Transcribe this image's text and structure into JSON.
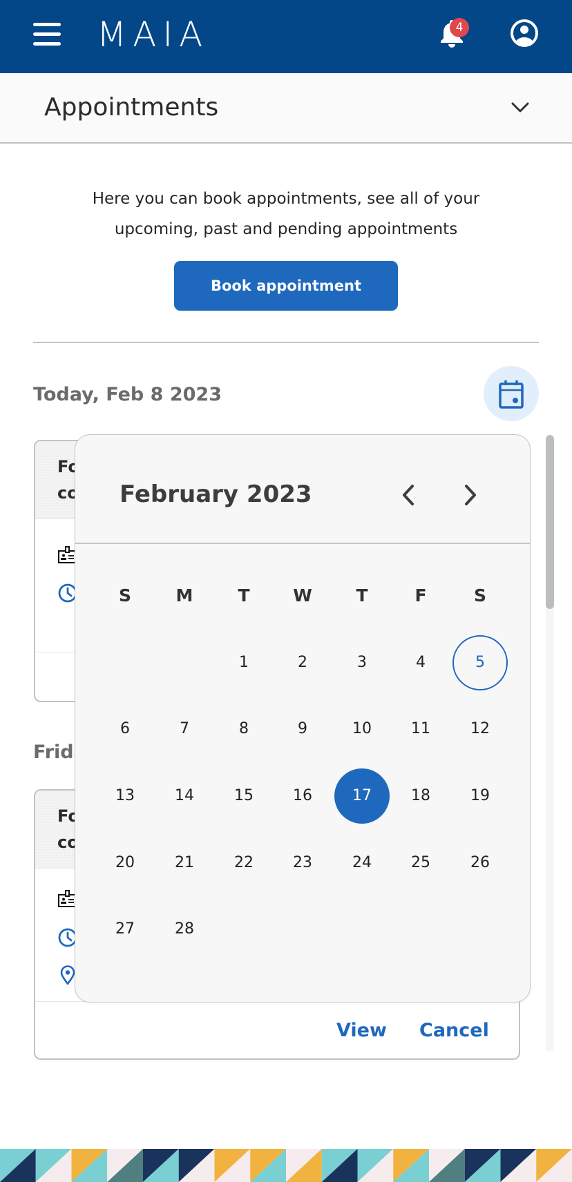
{
  "app": {
    "brand": "MAIA",
    "notifications_count": "4",
    "icons": {
      "menu": "hamburger-menu-icon",
      "bell": "bell-icon",
      "profile": "user-circle-icon"
    }
  },
  "section": {
    "title": "Appointments",
    "dropdown_icon": "chevron-down-icon"
  },
  "intro": {
    "text": "Here you can book appointments, see all of your upcoming, past and pending appointments",
    "book_button": "Book appointment"
  },
  "groups": [
    {
      "date_label": "Today, Feb 8 2023",
      "card": {
        "title_line1": "Fo",
        "title_line2": "co",
        "icons": [
          "id-badge-icon",
          "clock-icon"
        ]
      }
    },
    {
      "date_label": "Frida",
      "card": {
        "title_line1": "Fo",
        "title_line2": "co",
        "icons": [
          "id-badge-icon",
          "clock-icon",
          "location-pin-icon"
        ],
        "actions": {
          "view": "View",
          "cancel": "Cancel"
        }
      }
    }
  ],
  "calendar_button_icon": "calendar-icon",
  "calendar": {
    "month_title": "February 2023",
    "prev_icon": "chevron-left-icon",
    "next_icon": "chevron-right-icon",
    "weekdays": [
      "S",
      "M",
      "T",
      "W",
      "T",
      "F",
      "S"
    ],
    "weeks": [
      [
        "",
        "",
        "1",
        "2",
        "3",
        "4",
        "5"
      ],
      [
        "6",
        "7",
        "8",
        "9",
        "10",
        "11",
        "12"
      ],
      [
        "13",
        "14",
        "15",
        "16",
        "17",
        "18",
        "19"
      ],
      [
        "20",
        "21",
        "22",
        "23",
        "24",
        "25",
        "26"
      ],
      [
        "27",
        "28",
        "",
        "",
        "",
        "",
        ""
      ]
    ],
    "outlined_day": "5",
    "selected_day": "17"
  },
  "colors": {
    "brand_navy": "#034789",
    "primary_blue": "#1e68bd",
    "badge_red": "#e0484b",
    "calendar_button_bg": "#e1eefb",
    "band": {
      "teal": "#79cfd1",
      "navy": "#1a335c",
      "pink": "#f6eced",
      "orange": "#f2b23f",
      "dark_teal": "#4f7f80"
    }
  },
  "band_tiles": [
    [
      "teal",
      "navy"
    ],
    [
      "teal",
      "pink"
    ],
    [
      "orange",
      "teal"
    ],
    [
      "pink",
      "dark_teal"
    ],
    [
      "navy",
      "teal"
    ],
    [
      "navy",
      "pink"
    ],
    [
      "orange",
      "pink"
    ],
    [
      "orange",
      "teal"
    ],
    [
      "pink",
      "orange"
    ],
    [
      "teal",
      "navy"
    ],
    [
      "teal",
      "pink"
    ],
    [
      "orange",
      "teal"
    ],
    [
      "pink",
      "dark_teal"
    ],
    [
      "navy",
      "teal"
    ],
    [
      "navy",
      "pink"
    ],
    [
      "orange",
      "pink"
    ]
  ]
}
